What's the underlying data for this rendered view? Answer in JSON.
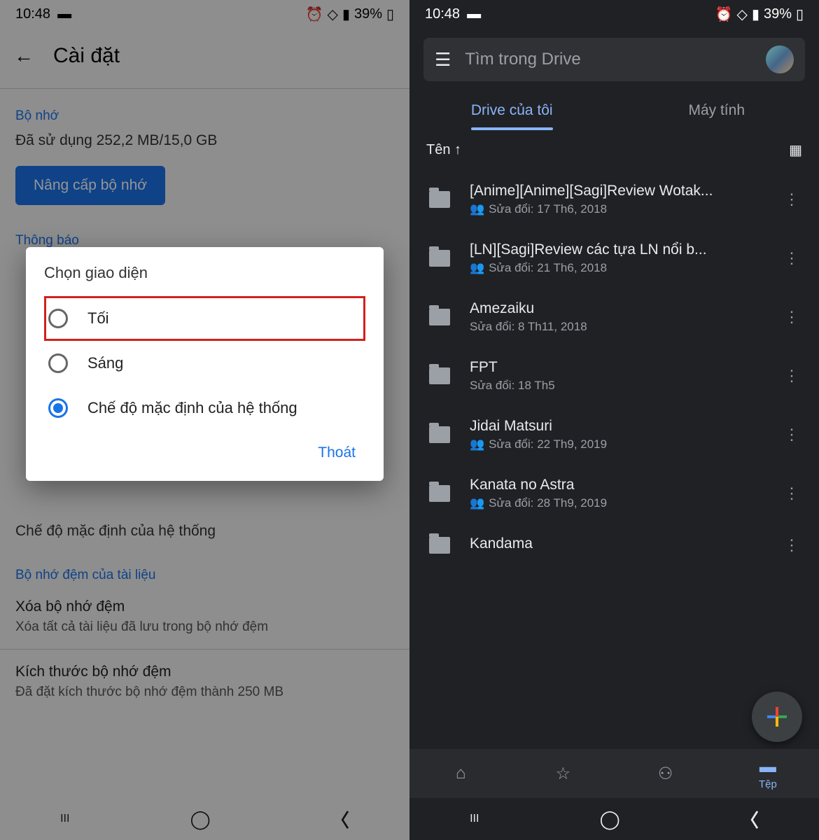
{
  "status": {
    "time": "10:48",
    "battery": "39%"
  },
  "left": {
    "title": "Cài đặt",
    "storage_header": "Bộ nhớ",
    "storage_usage": "Đã sử dụng 252,2 MB/15,0 GB",
    "upgrade": "Nâng cấp bộ nhớ",
    "notif_header": "Thông báo",
    "theme_sub": "Chế độ mặc định của hệ thống",
    "cache_header": "Bộ nhớ đệm của tài liệu",
    "clear_cache": "Xóa bộ nhớ đệm",
    "clear_cache_sub": "Xóa tất cả tài liệu đã lưu trong bộ nhớ đệm",
    "cache_size": "Kích thước bộ nhớ đệm",
    "cache_size_sub": "Đã đặt kích thước bộ nhớ đệm thành 250 MB",
    "dialog": {
      "title": "Chọn giao diện",
      "opt1": "Tối",
      "opt2": "Sáng",
      "opt3": "Chế độ mặc định của hệ thống",
      "exit": "Thoát"
    }
  },
  "right": {
    "search": "Tìm trong Drive",
    "tab1": "Drive của tôi",
    "tab2": "Máy tính",
    "sort": "Tên ↑",
    "files": [
      {
        "name": "[Anime][Anime][Sagi]Review Wotak...",
        "meta": "Sửa đổi: 17 Th6, 2018",
        "shared": true
      },
      {
        "name": "[LN][Sagi]Review các tựa LN nổi b...",
        "meta": "Sửa đổi: 21 Th6, 2018",
        "shared": true
      },
      {
        "name": "Amezaiku",
        "meta": "Sửa đổi: 8 Th11, 2018",
        "shared": false
      },
      {
        "name": "FPT",
        "meta": "Sửa đổi: 18 Th5",
        "shared": false
      },
      {
        "name": "Jidai Matsuri",
        "meta": "Sửa đổi: 22 Th9, 2019",
        "shared": true
      },
      {
        "name": "Kanata no Astra",
        "meta": "Sửa đổi: 28 Th9, 2019",
        "shared": true
      },
      {
        "name": "Kandama",
        "meta": "",
        "shared": false
      }
    ],
    "nav_files": "Tệp"
  }
}
